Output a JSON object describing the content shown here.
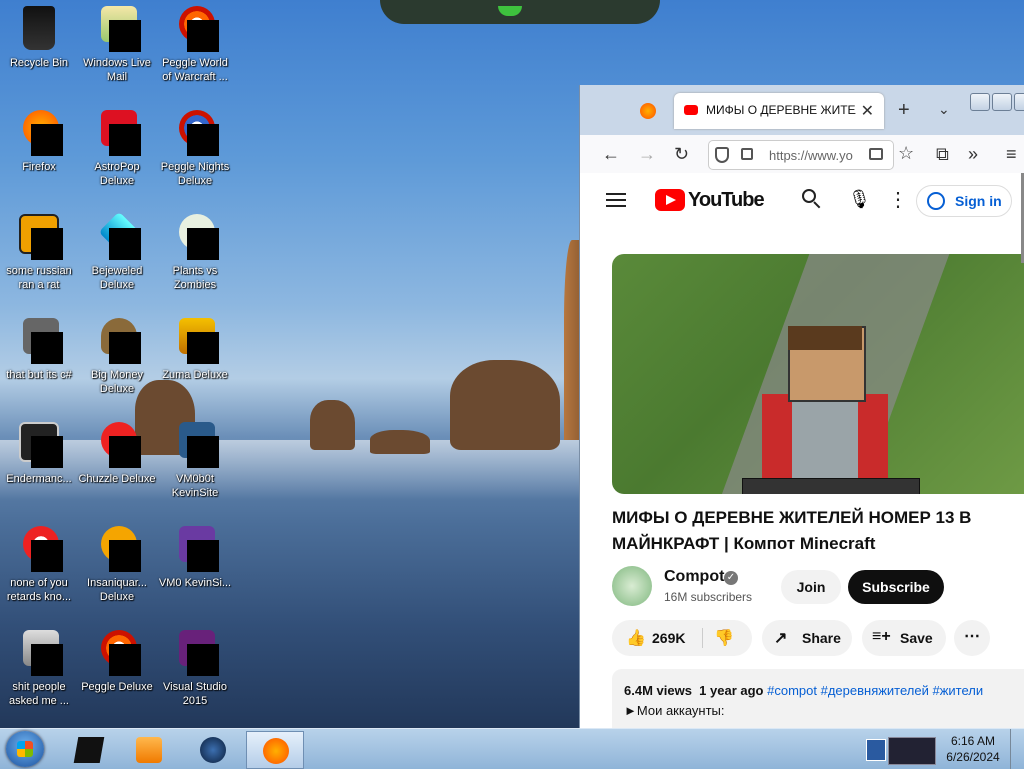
{
  "desktop": {
    "icons": [
      {
        "label": "Recycle Bin"
      },
      {
        "label": "Windows Live Mail"
      },
      {
        "label": "Peggle World of Warcraft ..."
      },
      {
        "label": "Firefox"
      },
      {
        "label": "AstroPop Deluxe"
      },
      {
        "label": "Peggle Nights Deluxe"
      },
      {
        "label": "some russian ran a rat"
      },
      {
        "label": "Bejeweled Deluxe"
      },
      {
        "label": "Plants vs Zombies"
      },
      {
        "label": "that but its c#"
      },
      {
        "label": "Big Money Deluxe"
      },
      {
        "label": "Zuma Deluxe"
      },
      {
        "label": "Endermanc..."
      },
      {
        "label": "Chuzzle Deluxe"
      },
      {
        "label": "VM0b0t KevinSite"
      },
      {
        "label": "none of you retards kno..."
      },
      {
        "label": "Insaniquar... Deluxe"
      },
      {
        "label": "VM0 KevinSi..."
      },
      {
        "label": "shit people asked me ..."
      },
      {
        "label": "Peggle Deluxe"
      },
      {
        "label": "Visual Studio 2015"
      }
    ]
  },
  "taskbar": {
    "clock_time": "6:16 AM",
    "clock_date": "6/26/2024"
  },
  "browser": {
    "tab_title": "МИФЫ О ДЕРЕВНЕ ЖИТЕЛЕ",
    "url": "https://www.yo",
    "new_tab": "+",
    "close_tab": "✕"
  },
  "youtube": {
    "logo_text": "YouTube",
    "sign_in": "Sign in",
    "video_title": "МИФЫ О ДЕРЕВНЕ ЖИТЕЛЕЙ НОМЕР 13 В МАЙНКРАФТ | Компот Minecraft",
    "channel_name": "Compot",
    "subscribers": "16M subscribers",
    "join": "Join",
    "subscribe": "Subscribe",
    "likes": "269K",
    "share": "Share",
    "save": "Save",
    "views": "6.4M views",
    "age": "1 year ago",
    "tags": "#compot #деревняжителей #жители",
    "desc_line": "►Мои аккаунты:"
  }
}
